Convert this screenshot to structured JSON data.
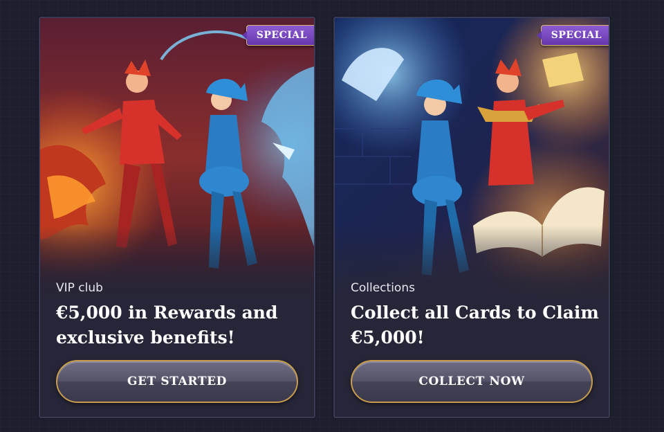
{
  "cards": [
    {
      "badge": "SPECIAL",
      "category": "VIP club",
      "headline": "€5,000 in Rewards and exclusive benefits!",
      "button": "GET STARTED"
    },
    {
      "badge": "SPECIAL",
      "category": "Collections",
      "headline": "Collect all Cards to Claim €5,000!",
      "button": "COLLECT NOW"
    }
  ],
  "colors": {
    "page_background": "#1d1e2e",
    "badge_purple": "#7a4ac2",
    "button_border_gold": "#c79d4d"
  }
}
